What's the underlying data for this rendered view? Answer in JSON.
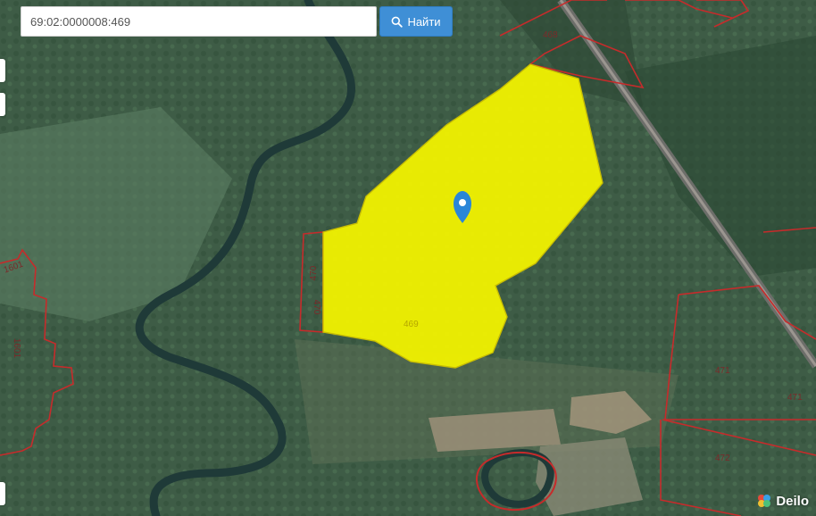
{
  "search": {
    "value": "69:02:0000008:469",
    "button_label": "Найти",
    "button_icon": "search-icon"
  },
  "parcels": {
    "selected": "469",
    "labels": {
      "p468": "468",
      "p470a": "470",
      "p470b": "470",
      "p469": "469",
      "p1601a": "1601",
      "p1601b": "1601",
      "p471a": "471",
      "p471b": "471",
      "p472": "472"
    }
  },
  "colors": {
    "selected_fill": "#f2f200",
    "boundary": "#c62b2b",
    "marker": "#2a86d8",
    "button": "#3f8fd6"
  },
  "brand": {
    "name": "Deilo"
  },
  "marker_icon": "map-pin-icon"
}
